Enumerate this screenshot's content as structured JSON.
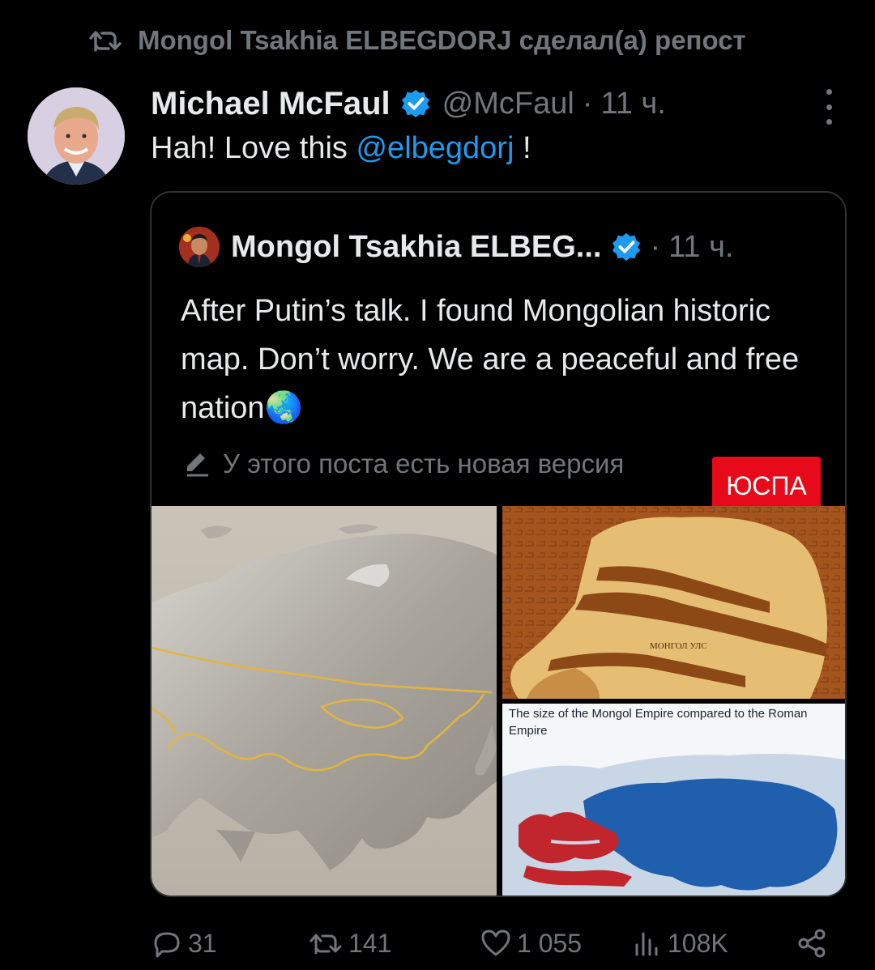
{
  "repost": {
    "icon": "repost-icon",
    "text": "Mongol Tsakhia ELBEGDORJ сделал(а) репост"
  },
  "tweet": {
    "author_name": "Michael McFaul",
    "handle": "@McFaul",
    "separator": "·",
    "time": "11 ч.",
    "text_before": "Hah! Love this ",
    "mention": "@elbegdorj",
    "text_after": " !"
  },
  "quote": {
    "author_name": "Mongol Tsakhia ELBEG...",
    "separator": "·",
    "time": "11 ч.",
    "text": "After Putin’s talk. I found Mongolian historic map. Don’t worry. We are a peaceful and free nation",
    "emoji": "🌏",
    "new_version_notice": "У этого поста есть новая версия",
    "overlay_badge": "ЮСПА",
    "images": {
      "bottom_right_caption": "The size of the Mongol Empire compared to the Roman Empire",
      "top_right_label_center": "МОНГОЛ УЛС"
    }
  },
  "actions": {
    "replies": "31",
    "reposts": "141",
    "likes": "1 055",
    "views": "108K"
  },
  "colors": {
    "background": "#000000",
    "text_primary": "#e7e9ea",
    "text_secondary": "#71767b",
    "link": "#1d9bf0",
    "verified": "#1d9bf0",
    "badge_red": "#e8091a",
    "roman_red": "#c0262b",
    "mongol_blue": "#1f5fae"
  }
}
